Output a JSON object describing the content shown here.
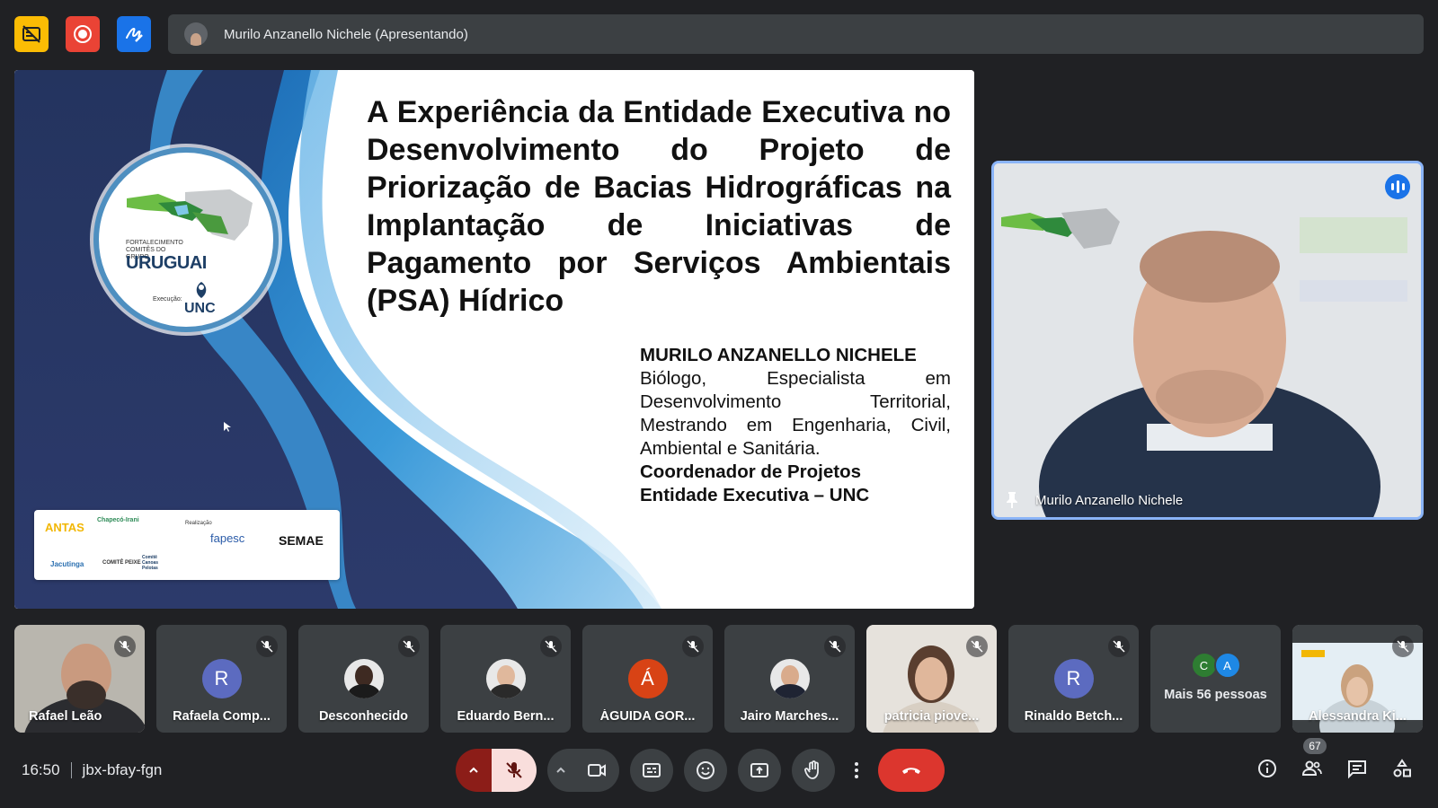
{
  "topbar": {
    "presenter_label": "Murilo Anzanello Nichele (Apresentando)",
    "icons": [
      "stop-captions-icon",
      "record-icon",
      "whiteboard-icon"
    ]
  },
  "slide": {
    "title": "A Experiência da Entidade Executiva no Desenvolvimento do Projeto de Priorização de Bacias Hidrográficas na Implantação de Iniciativas de Pagamento por Serviços Ambientais (PSA) Hídrico",
    "author_name": "MURILO ANZANELLO NICHELE",
    "author_description": "Biólogo, Especialista em Desenvolvimento Territorial, Mestrando em Engenharia, Civil, Ambiental e Sanitária.",
    "author_role_1": "Coordenador de Projetos",
    "author_role_2": "Entidade Executiva – UNC",
    "logo": {
      "caption": "FORTALECIMENTO COMITÊS DO GRUPO",
      "name": "URUGUAI",
      "exec_label": "Execução:",
      "exec_org": "UNC"
    },
    "sponsors": [
      "ANTAS",
      "Chapecó-Irani",
      "Jacutinga",
      "COMITÊ PEIXE",
      "Comitê Canoas Pelotas",
      "Realização",
      "fapesc",
      "SEMAE"
    ]
  },
  "speaker": {
    "name": "Murilo Anzanello Nichele"
  },
  "participants": [
    {
      "name": "Rafael Leão",
      "type": "video"
    },
    {
      "name": "Rafaela Comp...",
      "type": "initial",
      "initial": "R",
      "color": "#5c6bc0"
    },
    {
      "name": "Desconhecido",
      "type": "photo",
      "face": "#3e2a22",
      "body": "#1b1b1b"
    },
    {
      "name": "Eduardo Bern...",
      "type": "photo",
      "face": "#e0b89c",
      "body": "#2a2a2a"
    },
    {
      "name": "ÁGUIDA GOR...",
      "type": "initial",
      "initial": "Á",
      "color": "#d84315"
    },
    {
      "name": "Jairo Marches...",
      "type": "photo",
      "face": "#d9ab8c",
      "body": "#1f2433"
    },
    {
      "name": "patricia piove...",
      "type": "video"
    },
    {
      "name": "Rinaldo Betch...",
      "type": "initial",
      "initial": "R",
      "color": "#5c6bc0"
    },
    {
      "name": "Alessandra Ki...",
      "type": "video"
    }
  ],
  "more_people": {
    "label": "Mais 56 pessoas",
    "avatars": [
      {
        "initial": "C",
        "color": "#2e7d32"
      },
      {
        "initial": "A",
        "color": "#1e88e5"
      }
    ]
  },
  "bottombar": {
    "time": "16:50",
    "meeting_code": "jbx-bfay-fgn",
    "participant_count": "67",
    "colors": {
      "leave": "#dc362e",
      "mic_muted_bg": "#f9dedc",
      "accent": "#8ab4f8"
    }
  }
}
